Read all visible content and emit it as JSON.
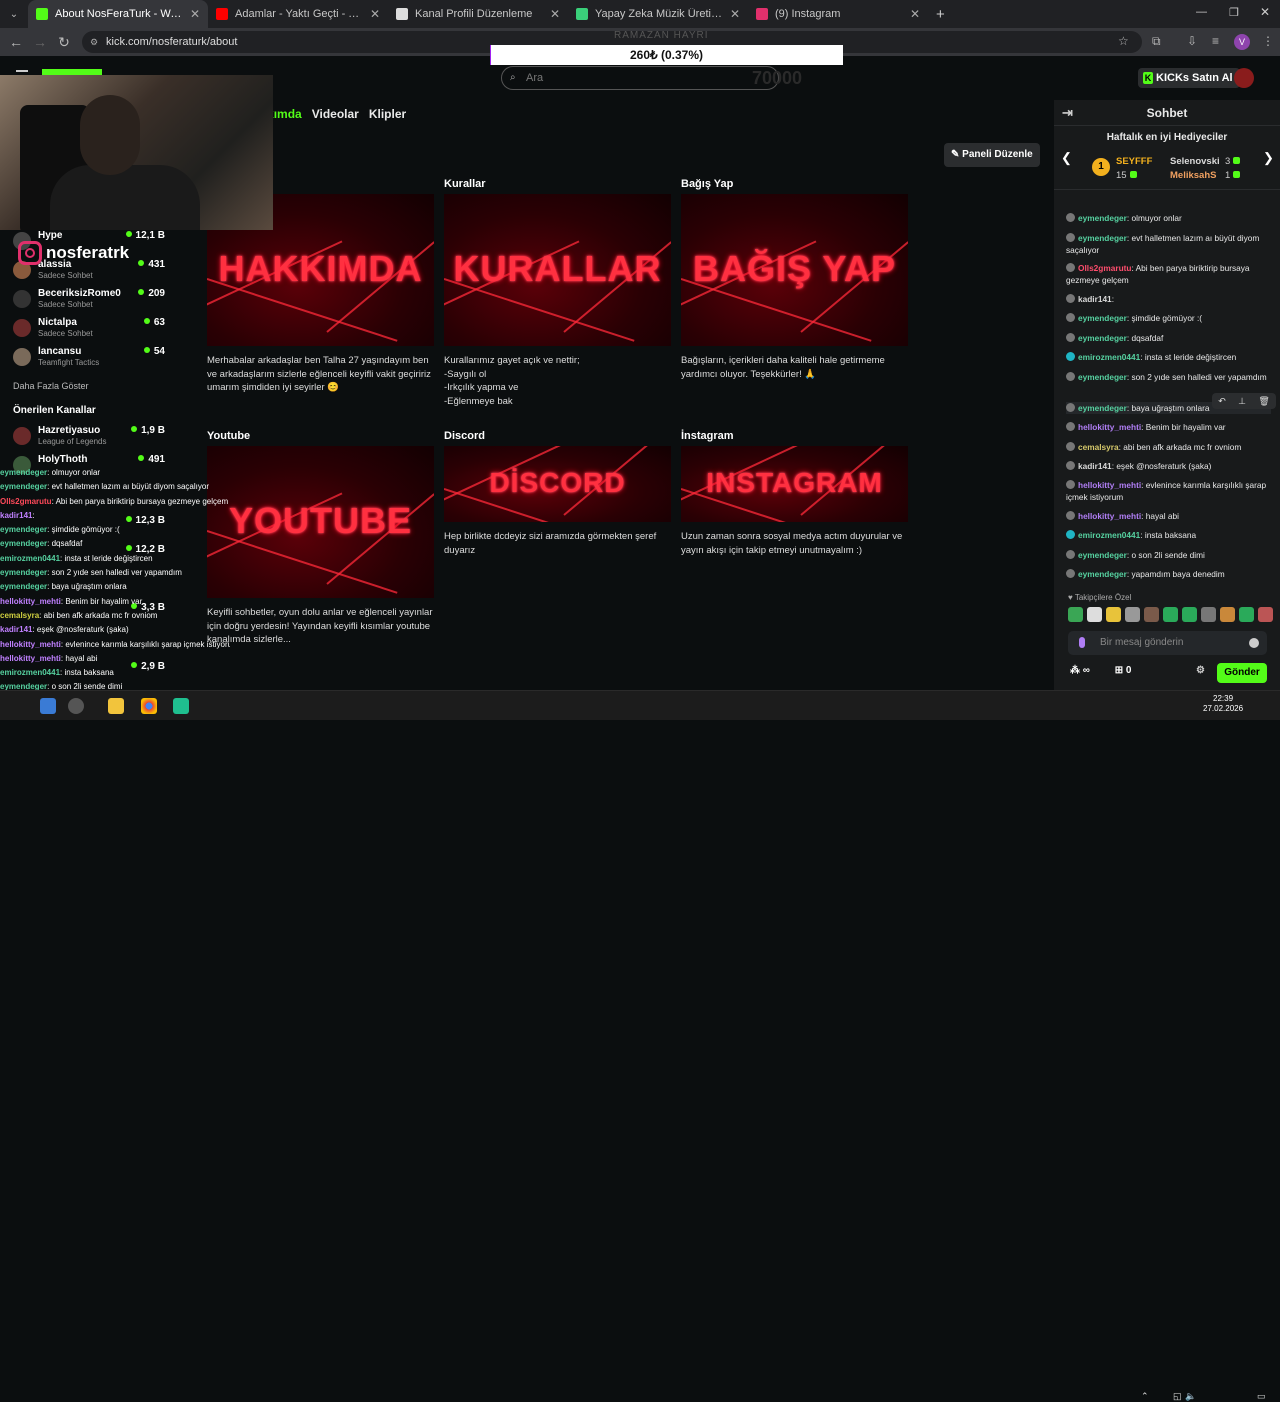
{
  "browser": {
    "tabs": [
      {
        "title": "About NosFeraTurk - Watch Liv",
        "color": "#53fc18",
        "active": true
      },
      {
        "title": "Adamlar - Yaktı Geçti - You",
        "color": "#ff0000",
        "active": false
      },
      {
        "title": "Kanal Profili Düzenleme",
        "color": "#dddddd",
        "active": false
      },
      {
        "title": "Yapay Zeka Müzik Üretici | Fikir",
        "color": "#3ad07a",
        "active": false
      },
      {
        "title": "(9) Instagram",
        "color": "#e1306c",
        "active": false
      }
    ],
    "url": "kick.com/nosferaturk/about",
    "profile_letter": "V"
  },
  "stream": {
    "ramazan_label": "RAMAZAN HAYRI",
    "donation_text": "260₺ (0.37%)",
    "donation_progress_percent": 0.37,
    "goal_text": "70000",
    "search_placeholder": "Ara",
    "kicks_button": "KICKs Satın Al",
    "instagram_handle": "nosferatrk"
  },
  "sidebar": {
    "channels": [
      {
        "name": "Hype",
        "category": "",
        "viewers": "12,1 B"
      },
      {
        "name": "alassia",
        "category": "Sadece Sohbet",
        "viewers": "431"
      },
      {
        "name": "BeceriksizRome0",
        "category": "Sadece Sohbet",
        "viewers": "209"
      },
      {
        "name": "Nictalpa",
        "category": "Sadece Sohbet",
        "viewers": "63"
      },
      {
        "name": "lancansu",
        "category": "Teamfight Tactics",
        "viewers": "54"
      }
    ],
    "show_more": "Daha Fazla Göster",
    "recommended_title": "Önerilen Kanallar",
    "recommended": [
      {
        "name": "Hazretiyasuo",
        "category": "League of Legends",
        "viewers": "1,9 B"
      },
      {
        "name": "HolyThoth",
        "category": "",
        "viewers": "491"
      }
    ],
    "obscured_viewers": [
      "12,3 B",
      "12,2 B",
      "3,3 B",
      "2,9 B"
    ]
  },
  "overlay_chat": [
    {
      "user": "eymendeger",
      "text": "olmuyor onlar",
      "color": "g"
    },
    {
      "user": "eymendeger",
      "text": "evt halletmen lazım aı büyüt diyom saçalıyor",
      "color": "g"
    },
    {
      "user": "Olls2gmarutu",
      "text": "Abi ben parya biriktirip bursaya gezmeye gelçem",
      "color": "r"
    },
    {
      "user": "kadir141",
      "text": "",
      "color": "w"
    },
    {
      "user": "eymendeger",
      "text": "şimdide gömüyor :(",
      "color": "g"
    },
    {
      "user": "eymendeger",
      "text": "dqsafdaf",
      "color": "g"
    },
    {
      "user": "emirozmen0441",
      "text": "insta st leride değiştircen",
      "color": "g"
    },
    {
      "user": "eymendeger",
      "text": "son 2 yıde sen halledi ver yapamdım",
      "color": "g"
    },
    {
      "user": "eymendeger",
      "text": "baya uğraştım onlara",
      "color": "g"
    },
    {
      "user": "hellokitty_mehti",
      "text": "Benim bir hayalim var",
      "color": "p"
    },
    {
      "user": "cemalsyra",
      "text": "abi ben afk arkada mc fr ovniom",
      "color": "y"
    },
    {
      "user": "kadir141",
      "text": "eşek @nosferaturk (şaka)",
      "color": "w"
    },
    {
      "user": "hellokitty_mehti",
      "text": "evlenince karımla karşılıklı şarap içmek istiyorum",
      "color": "p"
    },
    {
      "user": "hellokitty_mehti",
      "text": "hayal abi",
      "color": "p"
    },
    {
      "user": "emirozmen0441",
      "text": "insta baksana",
      "color": "g"
    },
    {
      "user": "eymendeger",
      "text": "o son 2li sende dimi",
      "color": "g"
    },
    {
      "user": "eymendeger",
      "text": "yapamdım baya denedim",
      "color": "g"
    }
  ],
  "channel_tabs": {
    "about": "Hakkımda",
    "videos": "Videolar",
    "clips": "Klipler"
  },
  "edit_panels": "Paneli Düzenle",
  "panels": [
    {
      "heading": "",
      "banner": "HAKKIMDA",
      "desc": "Merhabalar arkadaşlar ben Talha 27 yaşındayım ben ve arkadaşlarım sizlerle eğlenceli keyifli vakit geçiririz umarım şimdiden iyi seyirler 😊"
    },
    {
      "heading": "Kurallar",
      "banner": "KURALLAR",
      "desc": "Kurallarımız gayet açık ve nettir;\n-Saygılı ol\n-Irkçılık yapma ve\n-Eğlenmeye bak"
    },
    {
      "heading": "Bağış Yap",
      "banner": "BAĞIŞ YAP",
      "desc": "Bağışların, içerikleri daha kaliteli hale getirmeme yardımcı oluyor. Teşekkürler! 🙏"
    },
    {
      "heading": "Youtube",
      "banner": "YOUTUBE",
      "desc": "Keyifli sohbetler, oyun dolu anlar ve eğlenceli yayınlar için doğru yerdesin! Yayından keyifli kısımlar youtube kanalımda sizlerle..."
    },
    {
      "heading": "Discord",
      "banner": "DİSCORD",
      "desc": "Hep birlikte dcdeyiz sizi aramızda görmekten şeref duyarız"
    },
    {
      "heading": "İnstagram",
      "banner": "INSTAGRAM",
      "desc": "Uzun zaman sonra sosyal medya actım duyurular ve yayın akışı için takip etmeyi unutmayalım :)"
    }
  ],
  "chat": {
    "title": "Sohbet",
    "gifters_title": "Haftalık en iyi Hediyeciler",
    "gifters": [
      {
        "name": "SEYFFF",
        "count": "15",
        "color": "#f2b01e"
      },
      {
        "name": "Selenovski",
        "count": "3",
        "color": "#d9d9d9"
      },
      {
        "name": "MeliksahS",
        "count": "1",
        "color": "#f0a060"
      }
    ],
    "messages": [
      {
        "user": "eymendeger",
        "text": "olmuyor onlar",
        "color": "g"
      },
      {
        "user": "eymendeger",
        "text": "evt halletmen lazım aı büyüt diyom saçalıyor",
        "color": "g"
      },
      {
        "user": "Olls2gmarutu",
        "text": "Abi ben parya biriktirip bursaya gezmeye gelçem",
        "color": "r"
      },
      {
        "user": "kadir141",
        "text": "",
        "color": "w"
      },
      {
        "user": "eymendeger",
        "text": "şimdide gömüyor :(",
        "color": "g"
      },
      {
        "user": "eymendeger",
        "text": "dqsafdaf",
        "color": "g"
      },
      {
        "user": "emirozmen0441",
        "text": "insta st leride değiştircen",
        "color": "g"
      },
      {
        "user": "eymendeger",
        "text": "son 2 yıde sen halledi ver yapamdım",
        "color": "g"
      },
      {
        "user": "eymendeger",
        "text": "baya uğraştım onlara",
        "color": "g"
      },
      {
        "user": "hellokitty_mehti",
        "text": "Benim bir hayalim var",
        "color": "p"
      },
      {
        "user": "cemalsyra",
        "text": "abi ben afk arkada mc fr ovniom",
        "color": "y"
      },
      {
        "user": "kadir141",
        "text": "eşek @nosferaturk (şaka)",
        "color": "w"
      },
      {
        "user": "hellokitty_mehti",
        "text": "evlenince karımla karşılıklı şarap içmek istiyorum",
        "color": "p"
      },
      {
        "user": "hellokitty_mehti",
        "text": "hayal abi",
        "color": "p"
      },
      {
        "user": "emirozmen0441",
        "text": "insta baksana",
        "color": "g"
      },
      {
        "user": "eymendeger",
        "text": "o son 2li sende dimi",
        "color": "g"
      },
      {
        "user": "eymendeger",
        "text": "yapamdım baya denedim",
        "color": "g"
      }
    ],
    "emotes_title": "Takipçilere Özel",
    "input_placeholder": "Bir mesaj gönderin",
    "infinity_label": "∞",
    "gift_count": "0",
    "send_button": "Gönder"
  },
  "taskbar": {
    "time": "22:39",
    "date": "27.02.2026"
  }
}
